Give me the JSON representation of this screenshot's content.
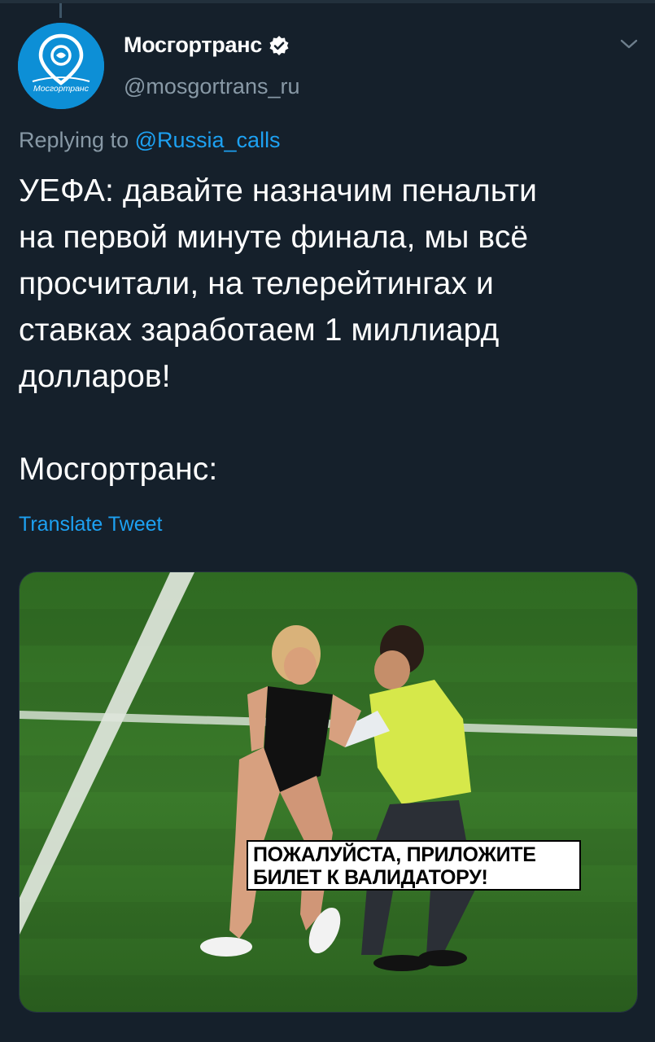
{
  "tweet": {
    "author": {
      "display_name": "Мосгортранс",
      "handle": "@mosgortrans_ru",
      "avatar_text": "Мосгортранс",
      "avatar_color": "#0d8fd6",
      "verified": true
    },
    "reply": {
      "prefix": "Replying to ",
      "to": "@Russia_calls"
    },
    "body": "УЕФА: давайте назначим пенальти\nна первой минуте финала, мы всё\nпросчитали, на телерейтингах и\nставках заработаем 1 миллиард\nдолларов!\n\nМосгортранс:",
    "translate_label": "Translate Tweet",
    "media": {
      "caption": "ПОЖАЛУЙСТА, ПРИЛОЖИТЕ\nБИЛЕТ К ВАЛИДАТОРУ!"
    }
  },
  "icons": {
    "verified": "verified-badge-icon",
    "menu": "chevron-down-icon"
  },
  "colors": {
    "background": "#15202b",
    "text_primary": "#ffffff",
    "text_secondary": "#8899a6",
    "link": "#1da1f2"
  }
}
